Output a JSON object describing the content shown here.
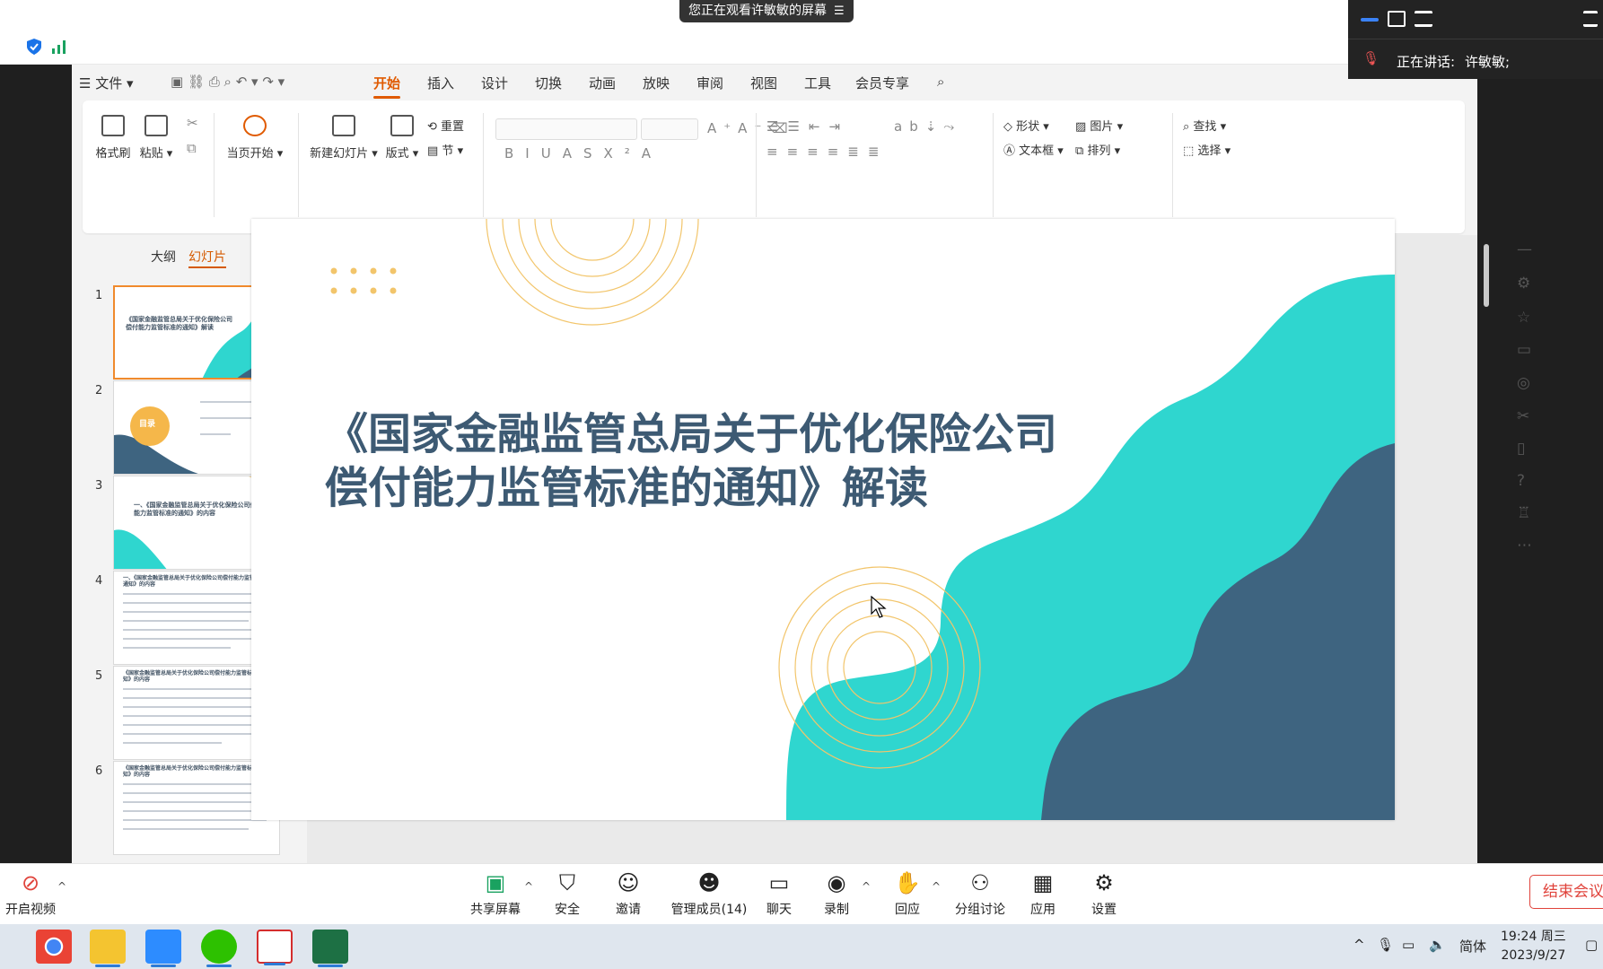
{
  "share_banner": {
    "text": "您正在观看许敏敏的屏幕",
    "icon": "menu-lines-icon"
  },
  "speaker": {
    "label": "正在讲话:",
    "name": "许敏敏;"
  },
  "wps": {
    "menu": {
      "file": "文件",
      "tabs": [
        "开始",
        "插入",
        "设计",
        "切换",
        "动画",
        "放映",
        "审阅",
        "视图",
        "工具",
        "会员专享"
      ],
      "active_tab": "开始"
    },
    "ribbon": {
      "format_painter": "格式刷",
      "paste": "粘贴",
      "play_from_current": "当页开始",
      "new_slide": "新建幻灯片",
      "layout": "版式",
      "reset": "重置",
      "section": "节",
      "shape": "形状",
      "picture": "图片",
      "find": "查找",
      "textbox": "文本框",
      "arrange": "排列",
      "select": "选择"
    },
    "panel_tabs": [
      "大纲",
      "幻灯片"
    ],
    "active_panel_tab": "幻灯片",
    "thumbnails": [
      {
        "num": "1",
        "title": "《国家金融监管总局关于优化保险公司偿付能力监管标准的通知》解读"
      },
      {
        "num": "2",
        "title": "目录"
      },
      {
        "num": "3",
        "title": "一、《国家金融监管总局关于优化保险公司偿付能力监管标准的通知》的内容"
      },
      {
        "num": "4",
        "title": "一、《国家金融监管总局关于优化保险公司偿付能力监管标准的通知》的内容"
      },
      {
        "num": "5",
        "title": "《国家金融监管总局关于优化保险公司偿付能力监管标准的通知》的内容"
      },
      {
        "num": "6",
        "title": "《国家金融监管总局关于优化保险公司偿付能力监管标准的通知》的内容"
      }
    ],
    "slide": {
      "title_line1": "《国家金融监管总局关于优化保险公司",
      "title_line2": "偿付能力监管标准的通知》解读",
      "colors": {
        "teal": "#2fd6cf",
        "navy": "#3e6480",
        "gold": "#f2c56b",
        "title": "#3d5a73"
      }
    }
  },
  "zoom_toolbar": {
    "video": "开启视频",
    "buttons": [
      "共享屏幕",
      "安全",
      "邀请",
      "管理成员(14)",
      "聊天",
      "录制",
      "回应",
      "分组讨论",
      "应用",
      "设置"
    ],
    "end": "结束会议"
  },
  "taskbar": {
    "ime": "简体",
    "time": "19:24 周三",
    "date": "2023/9/27"
  }
}
